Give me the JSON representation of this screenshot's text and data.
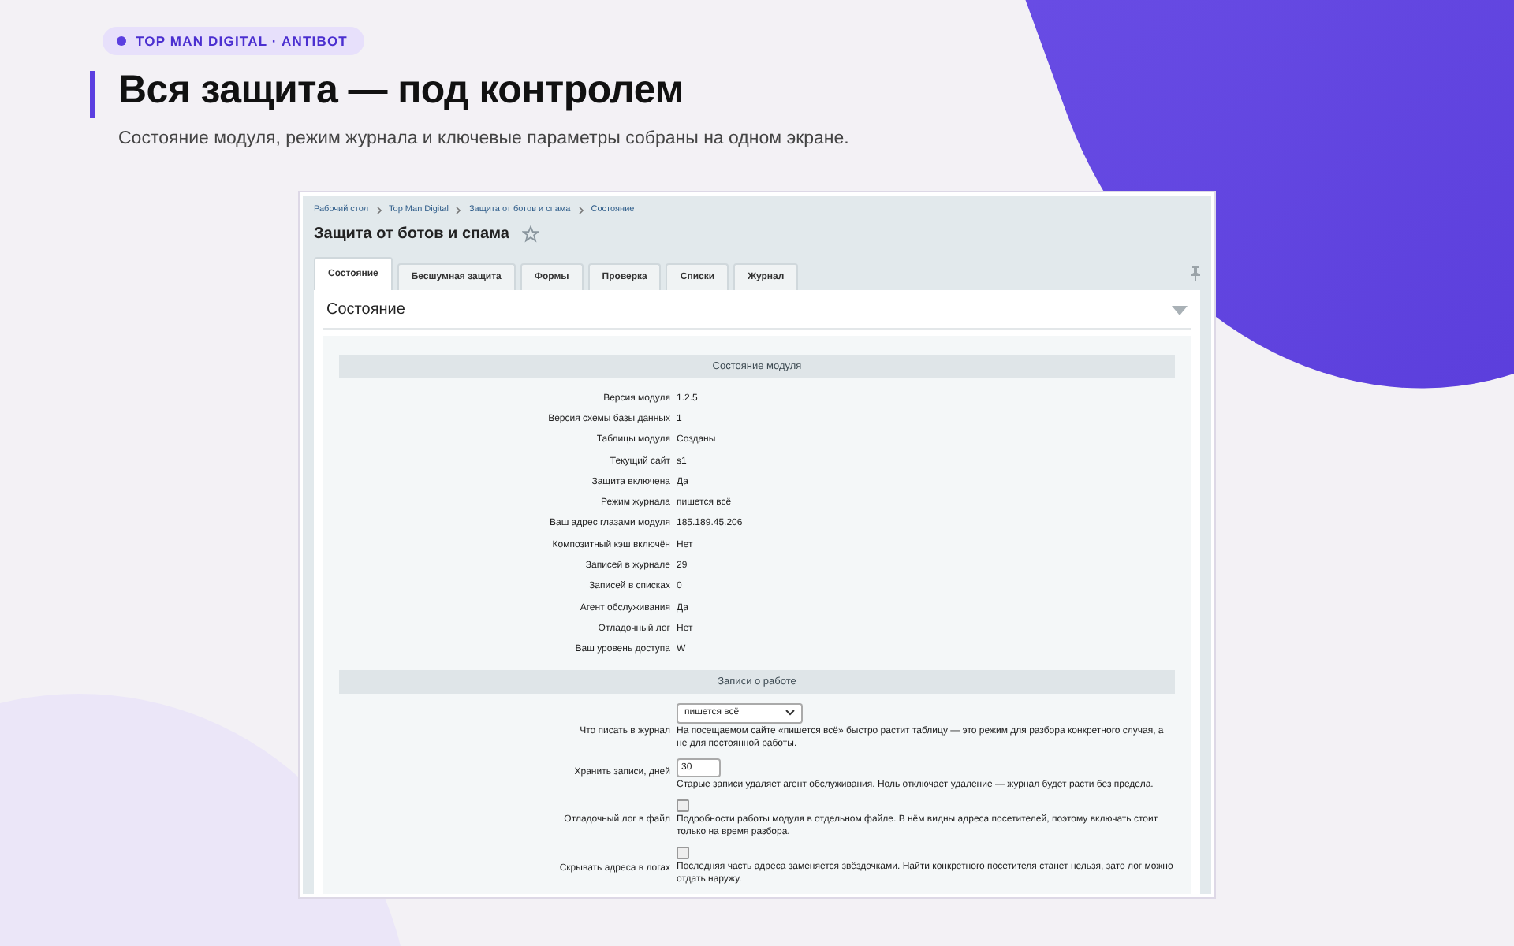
{
  "badge": {
    "label": "TOP MAN DIGITAL · ANTIBOT"
  },
  "headline": "Вся защита — под контролем",
  "subtitle": "Состояние модуля, режим журнала и ключевые параметры собраны на одном экране.",
  "admin": {
    "breadcrumbs": [
      "Рабочий стол",
      "Top Man Digital",
      "Защита от ботов и спама",
      "Состояние"
    ],
    "page_title": "Защита от ботов и спама",
    "tabs": [
      {
        "label": "Состояние",
        "selected": true
      },
      {
        "label": "Бесшумная защита",
        "selected": false
      },
      {
        "label": "Формы",
        "selected": false
      },
      {
        "label": "Проверка",
        "selected": false
      },
      {
        "label": "Списки",
        "selected": false
      },
      {
        "label": "Журнал",
        "selected": false
      }
    ],
    "panel_title": "Состояние",
    "status_section": {
      "title": "Состояние модуля",
      "rows": [
        {
          "label": "Версия модуля",
          "value": "1.2.5"
        },
        {
          "label": "Версия схемы базы данных",
          "value": "1"
        },
        {
          "label": "Таблицы модуля",
          "value": "Созданы"
        },
        {
          "label": "Текущий сайт",
          "value": "s1"
        },
        {
          "label": "Защита включена",
          "value": "Да"
        },
        {
          "label": "Режим журнала",
          "value": "пишется всё"
        },
        {
          "label": "Ваш адрес глазами модуля",
          "value": "185.189.45.206"
        },
        {
          "label": "Композитный кэш включён",
          "value": "Нет"
        },
        {
          "label": "Записей в журнале",
          "value": "29"
        },
        {
          "label": "Записей в списках",
          "value": "0"
        },
        {
          "label": "Агент обслуживания",
          "value": "Да"
        },
        {
          "label": "Отладочный лог",
          "value": "Нет"
        },
        {
          "label": "Ваш уровень доступа",
          "value": "W"
        }
      ]
    },
    "work_section": {
      "title": "Записи о работе",
      "fields": [
        {
          "kind": "select",
          "label": "Что писать в журнал",
          "value": "пишется всё",
          "hint": "На посещаемом сайте «пишется всё» быстро растит таблицу — это режим для разбора конкретного случая, а не для постоянной работы."
        },
        {
          "kind": "number",
          "label": "Хранить записи, дней",
          "value": "30",
          "hint": "Старые записи удаляет агент обслуживания. Ноль отключает удаление — журнал будет расти без предела."
        },
        {
          "kind": "checkbox",
          "label": "Отладочный лог в файл",
          "checked": false,
          "hint": "Подробности работы модуля в отдельном файле. В нём видны адреса посетителей, поэтому включать стоит только на время разбора."
        },
        {
          "kind": "checkbox",
          "label": "Скрывать адреса в логах",
          "checked": false,
          "hint": "Последняя часть адреса заменяется звёздочками. Найти конкретного посетителя станет нельзя, зато лог можно отдать наружу."
        }
      ]
    }
  }
}
